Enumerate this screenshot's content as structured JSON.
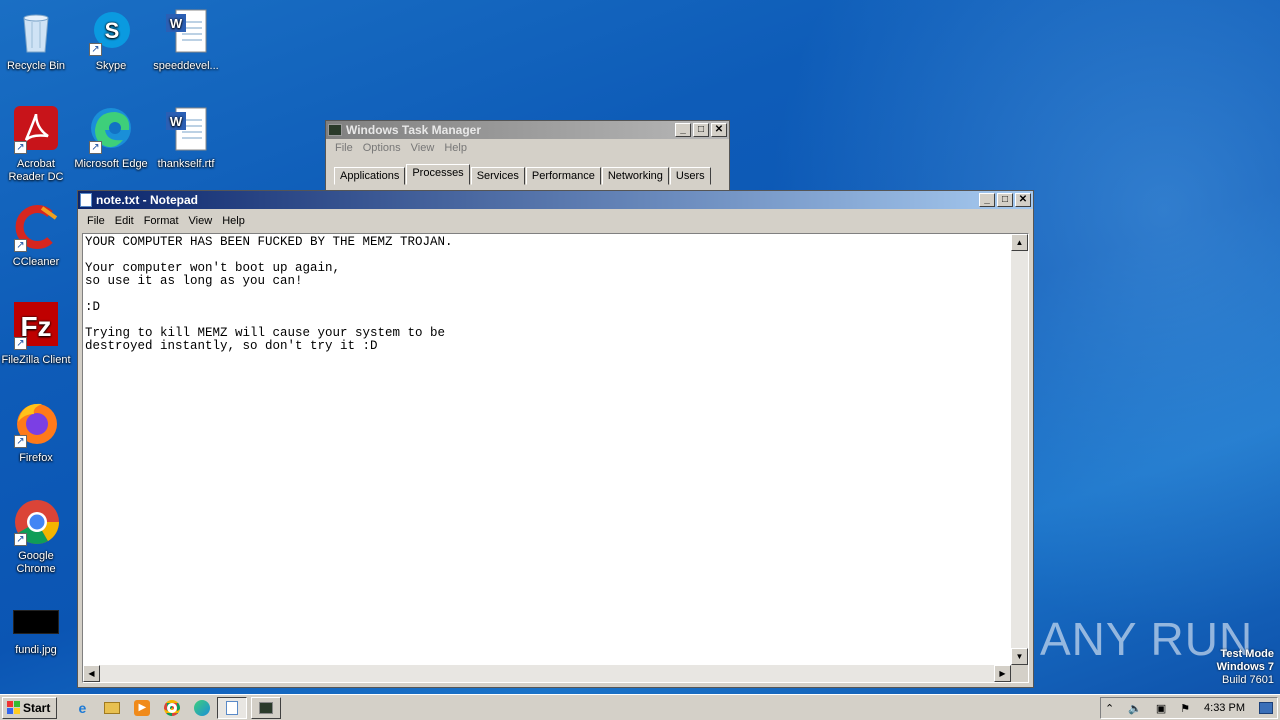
{
  "desktop": {
    "icons": [
      {
        "label": "Recycle Bin"
      },
      {
        "label": "Skype"
      },
      {
        "label": "speeddevel..."
      },
      {
        "label": "Acrobat Reader DC"
      },
      {
        "label": "Microsoft Edge"
      },
      {
        "label": "thankself.rtf"
      },
      {
        "label": "CCleaner"
      },
      {
        "label": "FileZilla Client"
      },
      {
        "label": "Firefox"
      },
      {
        "label": "Google Chrome"
      },
      {
        "label": "fundi.jpg"
      }
    ],
    "watermark": "ANY RUN",
    "test_mode": {
      "line1": "Test Mode",
      "line2": "Windows 7",
      "line3": "Build 7601"
    }
  },
  "task_manager": {
    "title": "Windows Task Manager",
    "menu": [
      "File",
      "Options",
      "View",
      "Help"
    ],
    "tabs": [
      "Applications",
      "Processes",
      "Services",
      "Performance",
      "Networking",
      "Users"
    ],
    "active_tab": "Processes"
  },
  "notepad": {
    "title": "note.txt - Notepad",
    "menu": [
      "File",
      "Edit",
      "Format",
      "View",
      "Help"
    ],
    "content": "YOUR COMPUTER HAS BEEN FUCKED BY THE MEMZ TROJAN.\n\nYour computer won't boot up again,\nso use it as long as you can!\n\n:D\n\nTrying to kill MEMZ will cause your system to be\ndestroyed instantly, so don't try it :D"
  },
  "taskbar": {
    "start_label": "Start",
    "clock": "4:33 PM"
  }
}
